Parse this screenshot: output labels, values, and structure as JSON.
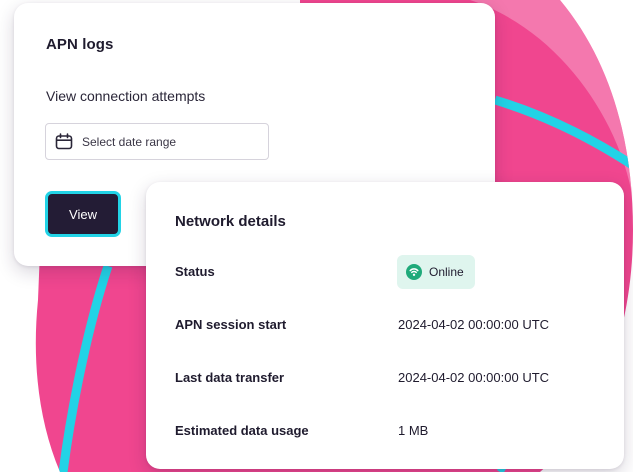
{
  "apn_logs": {
    "title": "APN logs",
    "subtitle": "View connection attempts",
    "date_input_placeholder": "Select date range",
    "date_icon": "calendar-icon",
    "view_button_label": "View"
  },
  "network_details": {
    "title": "Network details",
    "rows": [
      {
        "label": "Status",
        "value": "Online",
        "type": "badge",
        "icon": "online-signal-icon",
        "badge_color": "#dff5ee",
        "icon_color": "#1faa7a"
      },
      {
        "label": "APN session start",
        "value": "2024-04-02 00:00:00 UTC"
      },
      {
        "label": "Last data transfer",
        "value": "2024-04-02 00:00:00 UTC"
      },
      {
        "label": "Estimated data usage",
        "value": "1 MB"
      }
    ]
  },
  "colors": {
    "accent_pink": "#f0468f",
    "accent_cyan": "#22d3e6",
    "button_dark": "#231c35"
  }
}
